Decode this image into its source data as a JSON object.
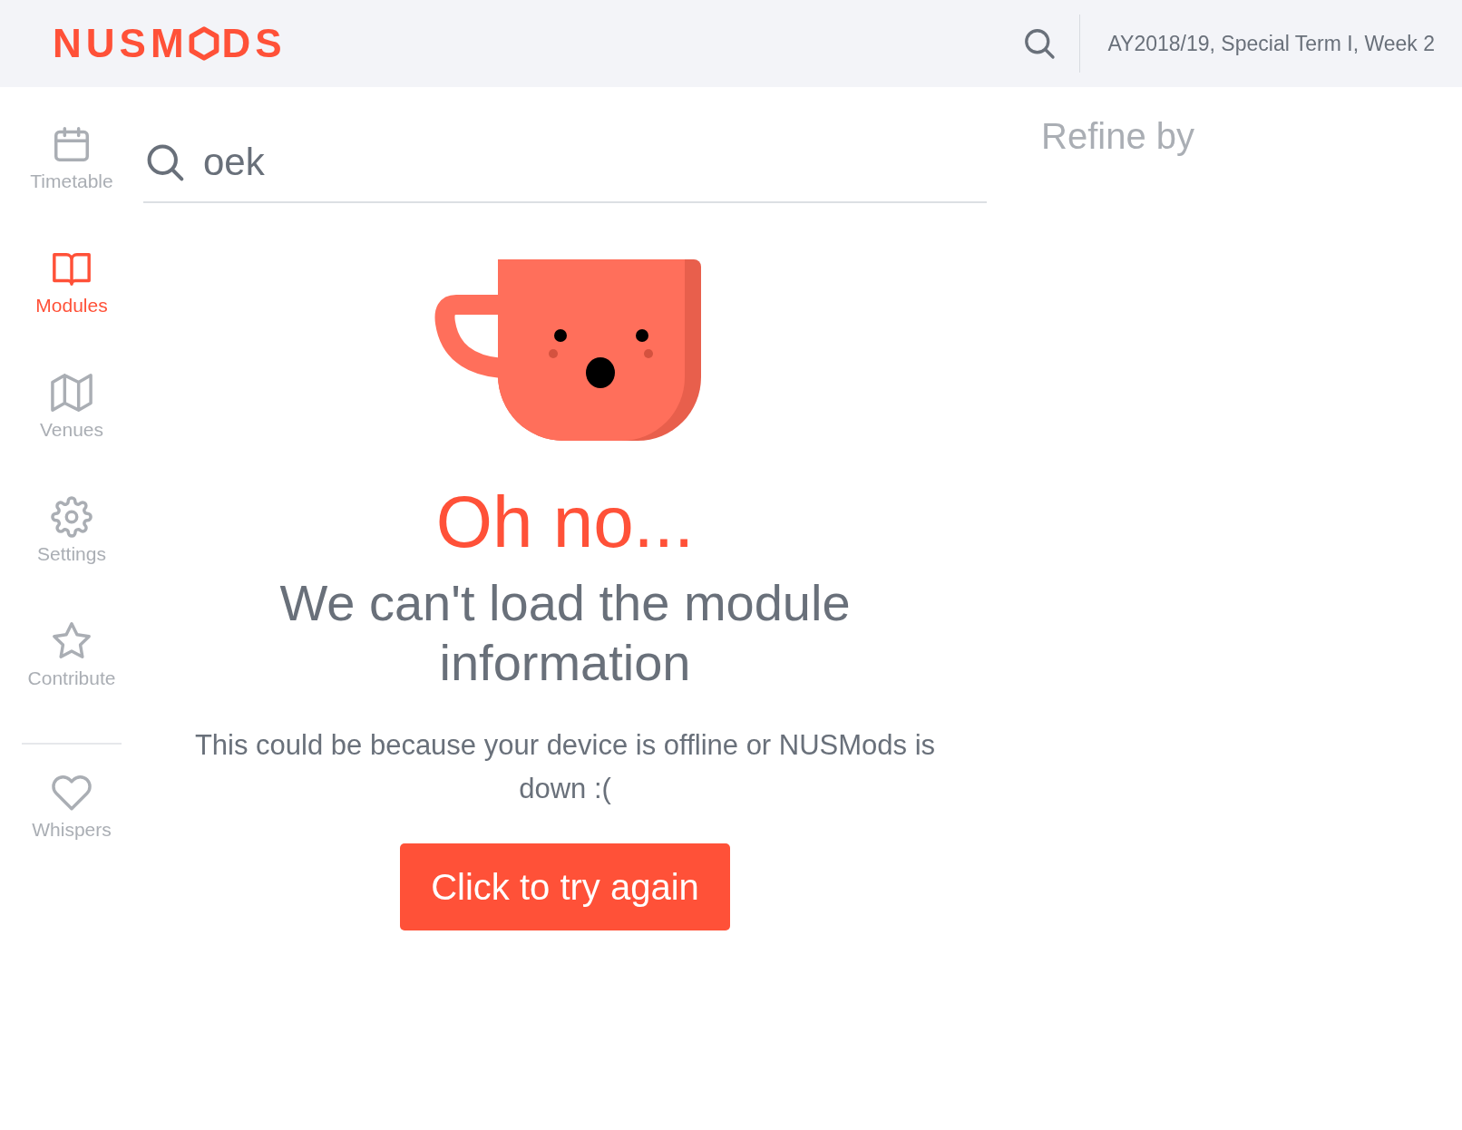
{
  "header": {
    "logo": {
      "before": "NUSM",
      "after": "DS"
    },
    "term": "AY2018/19, Special Term I, Week 2"
  },
  "sidebar": {
    "items": [
      {
        "label": "Timetable",
        "selected": false
      },
      {
        "label": "Modules",
        "selected": true
      },
      {
        "label": "Venues",
        "selected": false
      },
      {
        "label": "Settings",
        "selected": false
      },
      {
        "label": "Contribute",
        "selected": false
      }
    ],
    "secondary_items": [
      {
        "label": "Whispers",
        "selected": false
      }
    ]
  },
  "search": {
    "value": "oek"
  },
  "error": {
    "title": "Oh no...",
    "heading": "We can't load the module information",
    "message": "This could be because your device is offline or NUSMods is down :(",
    "button": "Click to try again"
  },
  "filters": {
    "title": "Refine by"
  }
}
